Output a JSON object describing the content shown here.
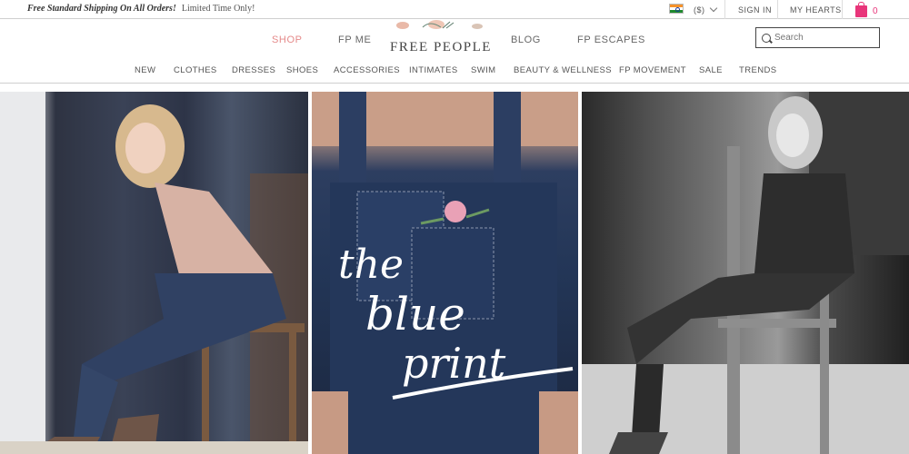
{
  "promo": {
    "bold": "Free Standard Shipping On All Orders!",
    "light": "Limited Time Only!"
  },
  "utility": {
    "currency": "($)",
    "signin": "SIGN IN",
    "hearts": "MY HEARTS",
    "cart_count": "0"
  },
  "main_nav": [
    {
      "label": "SHOP",
      "active": true
    },
    {
      "label": "FP ME",
      "active": false
    },
    {
      "label": "BLOG",
      "active": false
    },
    {
      "label": "FP ESCAPES",
      "active": false
    }
  ],
  "logo": {
    "text": "FREE PEOPLE"
  },
  "search": {
    "placeholder": "Search"
  },
  "categories": [
    "NEW",
    "CLOTHES",
    "DRESSES",
    "SHOES",
    "ACCESSORIES",
    "INTIMATES",
    "SWIM",
    "BEAUTY & WELLNESS",
    "FP MOVEMENT",
    "SALE",
    "TRENDS"
  ],
  "hero": {
    "script_line1": "the",
    "script_line2": "blue",
    "script_line3": "print"
  },
  "colors": {
    "accent": "#e8357a",
    "active_nav": "#e58a8a"
  },
  "icons": {
    "search": "search-icon",
    "cart": "shopping-bag-icon",
    "flag": "india-flag-icon",
    "chevron": "chevron-down-icon"
  }
}
